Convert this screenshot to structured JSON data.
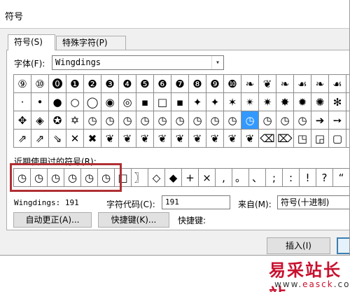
{
  "window": {
    "title": "符号"
  },
  "tabs": [
    {
      "label": "符号(S)",
      "active": true
    },
    {
      "label": "特殊字符(P)",
      "active": false
    }
  ],
  "font": {
    "label": "字体(F):",
    "value": "Wingdings"
  },
  "grid": {
    "selected": {
      "row": 2,
      "col": 13
    },
    "rows": [
      [
        "⑨",
        "⑩",
        "⓿",
        "❶",
        "❷",
        "❸",
        "❹",
        "❺",
        "❻",
        "❼",
        "❽",
        "❾",
        "❿",
        "❧",
        "❦",
        "❧",
        "☙",
        "❧",
        "☙",
        "❧"
      ],
      [
        "·",
        "•",
        "●",
        "○",
        "◯",
        "◉",
        "◎",
        "▪",
        "□",
        "▪",
        "✦",
        "✦",
        "✶",
        "✴",
        "✷",
        "✸",
        "✹",
        "✺",
        "✻",
        "❋"
      ],
      [
        "✥",
        "◈",
        "✪",
        "✡",
        "◷",
        "◷",
        "◷",
        "◷",
        "◷",
        "◷",
        "◷",
        "◷",
        "◷",
        "◷",
        "◷",
        "◷",
        "◷",
        "➔",
        "➙",
        "➘"
      ],
      [
        "⇗",
        "⇗",
        "⇘",
        "✕",
        "✖",
        "❦",
        "❦",
        "❦",
        "❦",
        "❦",
        "❦",
        "❦",
        "❦",
        "❦",
        "⌫",
        "⌦",
        "◳",
        "◲",
        "▢",
        "◰"
      ]
    ]
  },
  "recent": {
    "label": "近期使用过的符号(R):",
    "items": [
      "◷",
      "◷",
      "◷",
      "◷",
      "◷",
      "◷",
      "□",
      "〗",
      "◇",
      "◆",
      "+",
      "×",
      ",",
      "。",
      "、",
      ";",
      ":",
      "!",
      "?",
      "“"
    ]
  },
  "info": {
    "font_code": "Wingdings: 191",
    "char_code_label": "字符代码(C):",
    "char_code_value": "191",
    "from_label": "来自(M):",
    "from_value": "符号(十进制)"
  },
  "buttons": {
    "autocorrect": "自动更正(A)...",
    "shortcut": "快捷键(K)...",
    "shortcut_label": "快捷键:",
    "insert": "插入(I)"
  },
  "watermark": {
    "brand": "易采站长站",
    "url_pre": "www.",
    "url_mid": "easck",
    "url_post": ".com"
  }
}
